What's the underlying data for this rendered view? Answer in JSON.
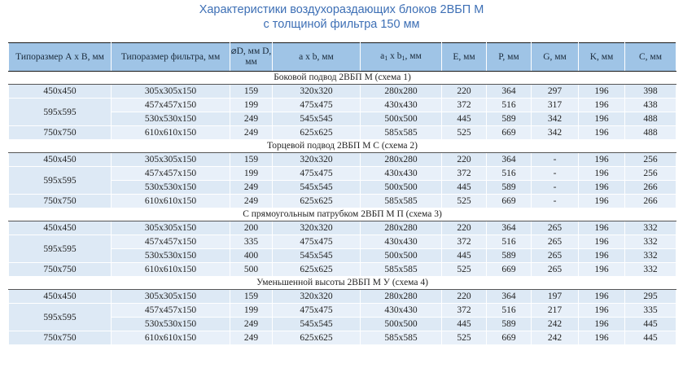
{
  "title": {
    "line1": "Характеристики воздухораздающих блоков 2ВБП М",
    "line2": "с толщиной фильтра 150 мм"
  },
  "headers": [
    "Типоразмер А х В, мм",
    "Типоразмер фильтра, мм",
    "⌀D, мм D, мм",
    "a x b, мм",
    "a1 x b1, мм",
    "E, мм",
    "P, мм",
    "G, мм",
    "K, мм",
    "C, мм"
  ],
  "sections": [
    {
      "title": "Боковой подвод 2ВБП М (схема 1)",
      "rows": [
        [
          "450x450",
          "305x305x150",
          "159",
          "320x320",
          "280x280",
          "220",
          "364",
          "297",
          "196",
          "398"
        ],
        [
          "595x595",
          "457x457x150",
          "199",
          "475x475",
          "430x430",
          "372",
          "516",
          "317",
          "196",
          "438"
        ],
        [
          "",
          "530x530x150",
          "249",
          "545x545",
          "500x500",
          "445",
          "589",
          "342",
          "196",
          "488"
        ],
        [
          "750x750",
          "610x610x150",
          "249",
          "625x625",
          "585x585",
          "525",
          "669",
          "342",
          "196",
          "488"
        ]
      ]
    },
    {
      "title": "Торцевой подвод 2ВБП М С (схема 2)",
      "rows": [
        [
          "450x450",
          "305x305x150",
          "159",
          "320x320",
          "280x280",
          "220",
          "364",
          "-",
          "196",
          "256"
        ],
        [
          "595x595",
          "457x457x150",
          "199",
          "475x475",
          "430x430",
          "372",
          "516",
          "-",
          "196",
          "256"
        ],
        [
          "",
          "530x530x150",
          "249",
          "545x545",
          "500x500",
          "445",
          "589",
          "-",
          "196",
          "266"
        ],
        [
          "750x750",
          "610x610x150",
          "249",
          "625x625",
          "585x585",
          "525",
          "669",
          "-",
          "196",
          "266"
        ]
      ]
    },
    {
      "title": "С прямоугольным патрубком 2ВБП М П (схема 3)",
      "rows": [
        [
          "450x450",
          "305x305x150",
          "200",
          "320x320",
          "280x280",
          "220",
          "364",
          "265",
          "196",
          "332"
        ],
        [
          "595x595",
          "457x457x150",
          "335",
          "475x475",
          "430x430",
          "372",
          "516",
          "265",
          "196",
          "332"
        ],
        [
          "",
          "530x530x150",
          "400",
          "545x545",
          "500x500",
          "445",
          "589",
          "265",
          "196",
          "332"
        ],
        [
          "750x750",
          "610x610x150",
          "500",
          "625x625",
          "585x585",
          "525",
          "669",
          "265",
          "196",
          "332"
        ]
      ]
    },
    {
      "title": "Уменьшенной высоты 2ВБП М У (схема 4)",
      "rows": [
        [
          "450x450",
          "305x305x150",
          "159",
          "320x320",
          "280x280",
          "220",
          "364",
          "197",
          "196",
          "295"
        ],
        [
          "595x595",
          "457x457x150",
          "199",
          "475x475",
          "430x430",
          "372",
          "516",
          "217",
          "196",
          "335"
        ],
        [
          "",
          "530x530x150",
          "249",
          "545x545",
          "500x500",
          "445",
          "589",
          "242",
          "196",
          "445"
        ],
        [
          "750x750",
          "610x610x150",
          "249",
          "625x625",
          "585x585",
          "525",
          "669",
          "242",
          "196",
          "445"
        ]
      ]
    }
  ]
}
